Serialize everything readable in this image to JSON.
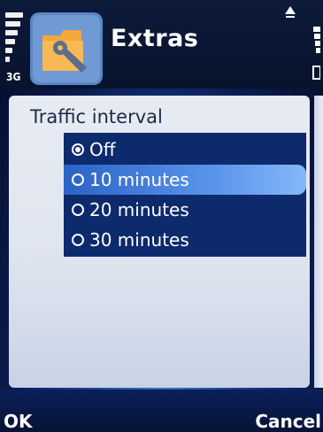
{
  "status": {
    "network": "3G"
  },
  "app": {
    "title": "Extras",
    "icon": "folder-wrench-icon"
  },
  "dialog": {
    "title": "Traffic interval",
    "options": [
      {
        "label": "Off",
        "selected": true,
        "highlighted": false
      },
      {
        "label": "10 minutes",
        "selected": false,
        "highlighted": true
      },
      {
        "label": "20 minutes",
        "selected": false,
        "highlighted": false
      },
      {
        "label": "30 minutes",
        "selected": false,
        "highlighted": false
      }
    ]
  },
  "softkeys": {
    "left": "OK",
    "right": "Cancel"
  },
  "colors": {
    "list_bg": "#0d2a6d",
    "highlight": "#5d97ec",
    "dialog_bg": "#e7ebf3"
  }
}
